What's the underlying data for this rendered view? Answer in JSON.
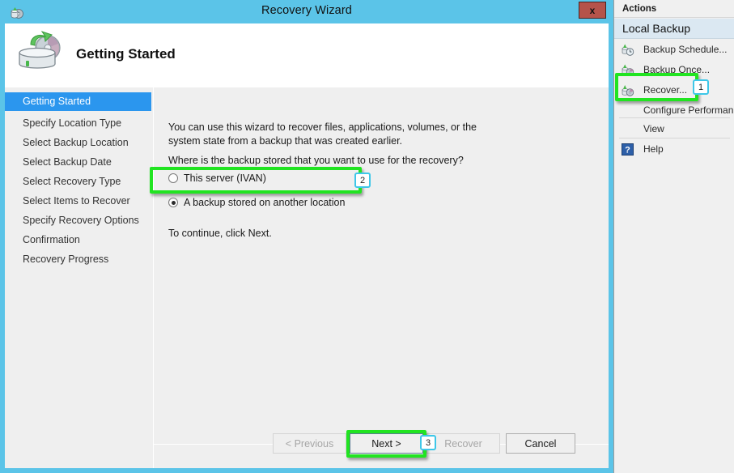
{
  "window": {
    "title": "Recovery Wizard",
    "title_icon": "recovery-wizard-icon",
    "close_label": "x",
    "header_title": "Getting Started",
    "header_icon": "restore-disk-icon"
  },
  "nav": {
    "items": [
      {
        "label": "Getting Started",
        "selected": true
      },
      {
        "label": "Specify Location Type",
        "selected": false
      },
      {
        "label": "Select Backup Location",
        "selected": false
      },
      {
        "label": "Select Backup Date",
        "selected": false
      },
      {
        "label": "Select Recovery Type",
        "selected": false
      },
      {
        "label": "Select Items to Recover",
        "selected": false
      },
      {
        "label": "Specify Recovery Options",
        "selected": false
      },
      {
        "label": "Confirmation",
        "selected": false
      },
      {
        "label": "Recovery Progress",
        "selected": false
      }
    ]
  },
  "content": {
    "intro": "You can use this wizard to recover files, applications, volumes, or the system state from a backup that was created earlier.",
    "question": "Where is the backup stored that you want to use for the recovery?",
    "option_local": "This server (IVAN)",
    "option_another": "A backup stored on another location",
    "footer": "To continue, click Next."
  },
  "buttons": {
    "previous": "< Previous",
    "next": "Next >",
    "recover": "Recover",
    "cancel": "Cancel"
  },
  "actions": {
    "caption": "Actions",
    "group": "Local Backup",
    "items": [
      {
        "label": "Backup Schedule...",
        "icon": "backup-schedule-icon"
      },
      {
        "label": "Backup Once...",
        "icon": "backup-once-icon"
      },
      {
        "label": "Recover...",
        "icon": "recover-icon"
      },
      {
        "label": "Configure Performan",
        "icon": "none"
      },
      {
        "label": "View",
        "icon": "none"
      },
      {
        "label": "Help",
        "icon": "help-icon"
      }
    ]
  },
  "annotations": {
    "badge_1": "1",
    "badge_2": "2",
    "badge_3": "3",
    "highlight_color": "#21e421",
    "badge_border_color": "#3ec7e8"
  }
}
